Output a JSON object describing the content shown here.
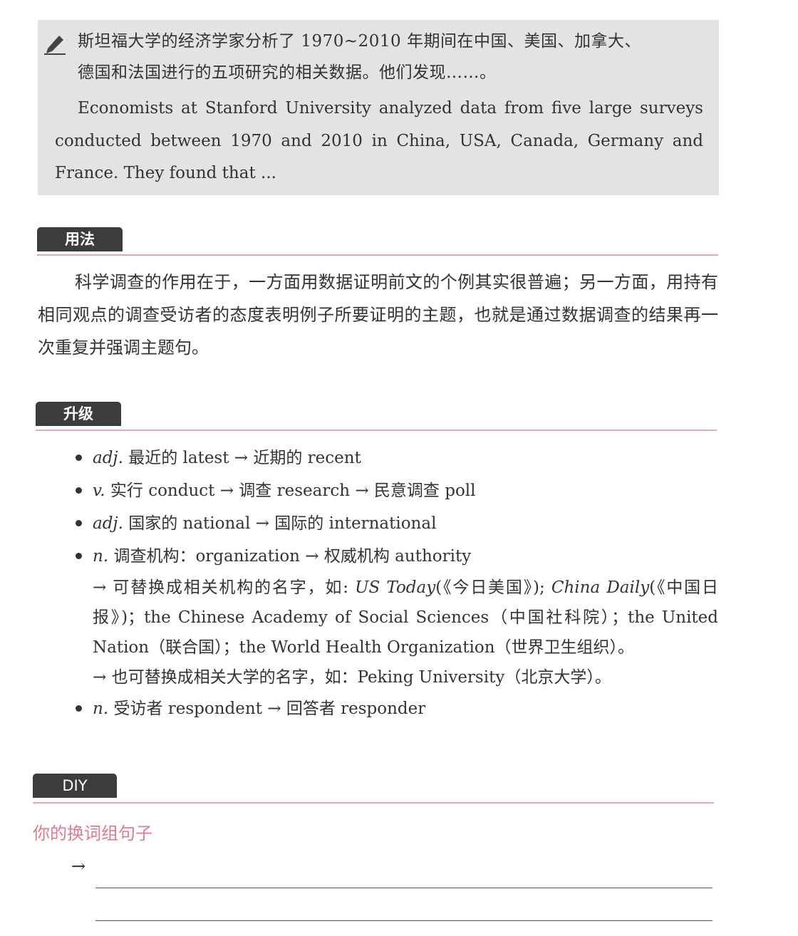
{
  "example": {
    "zh_line1": "斯坦福大学的经济学家分析了 1970~2010 年期间在中国、美国、加拿大、",
    "zh_line2": "德国和法国进行的五项研究的相关数据。他们发现……。",
    "en_text": "Economists at Stanford University analyzed data from five large surveys conducted between 1970 and 2010 in China, USA, Canada, Germany and France. They found that ..."
  },
  "usage": {
    "label": "用法",
    "text": "科学调查的作用在于，一方面用数据证明前文的个例其实很普遍；另一方面，用持有相同观点的调查受访者的态度表明例子所要证明的主题，也就是通过数据调查的结果再一次重复并强调主题句。"
  },
  "upgrade": {
    "label": "升级",
    "items": [
      {
        "pos": "adj.",
        "text": "最近的 latest → 近期的 recent"
      },
      {
        "pos": "v.",
        "text": "实行 conduct → 调查 research → 民意调查 poll"
      },
      {
        "pos": "adj.",
        "text": "国家的 national → 国际的 international"
      },
      {
        "pos": "n.",
        "text": "调查机构：organization → 权威机构 authority"
      },
      {
        "pos": "n.",
        "text": "受访者 respondent → 回答者 responder"
      }
    ],
    "cont1_a": "→ 可替换成相关机构的名字，如: ",
    "cont1_b": "US Today",
    "cont1_c": "(《今日美国》); ",
    "cont1_d": "China Daily",
    "cont1_e": "(《中国日报》)；the Chinese Academy of Social Sciences（中国社科院）；the United Nation（联合国）；the World Health Organization（世界卫生组织）。",
    "cont2": "→ 也可替换成相关大学的名字，如：Peking University（北京大学）。"
  },
  "diy": {
    "label": "DIY",
    "prompt": "你的换词组句子",
    "arrow": "→"
  },
  "colors": {
    "box_bg": "#e3e3e3",
    "label_bg": "#3c3c3c",
    "rule": "#e8a6b4",
    "prompt": "#e07a8f"
  }
}
